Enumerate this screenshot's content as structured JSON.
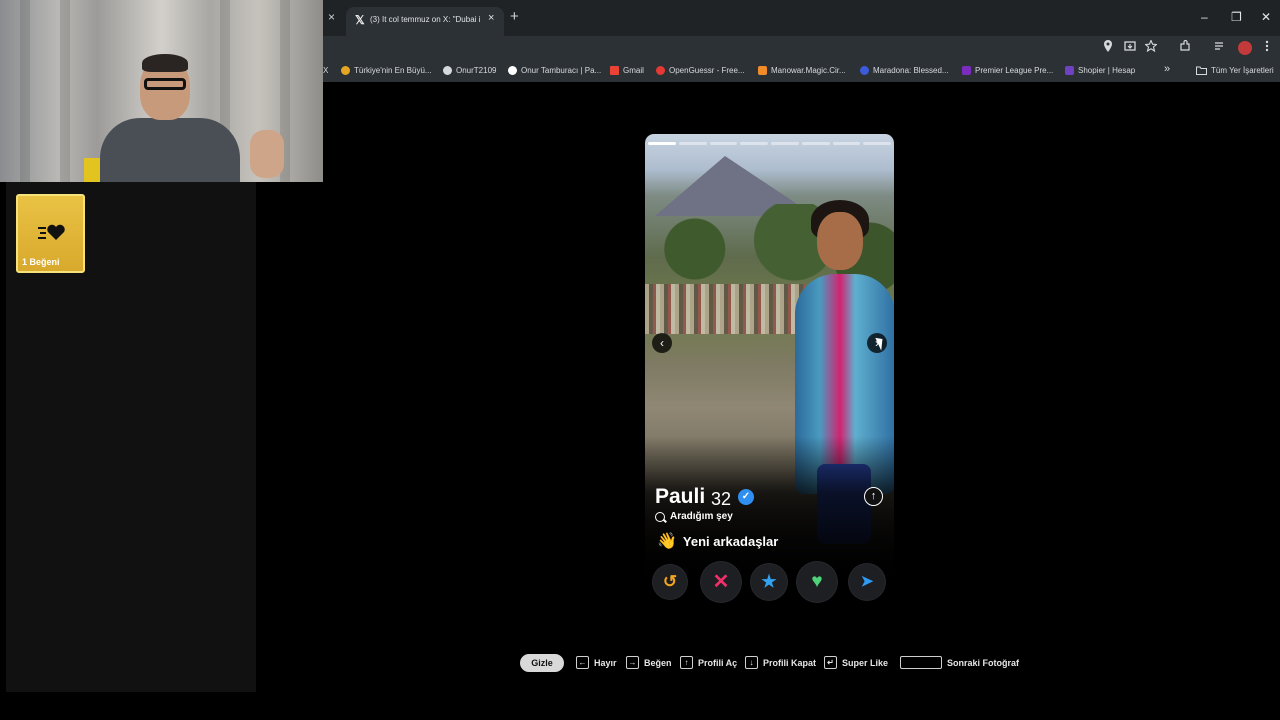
{
  "browser": {
    "tab": {
      "title": "(3) It col temmuz on X: \"Dubai i",
      "close": "×"
    },
    "other_tab_close": "×",
    "new_tab": "+",
    "window": {
      "minimize": "–",
      "restore": "❐",
      "close": "✕"
    },
    "toolbar_icons": [
      "location-icon",
      "install-icon",
      "star-icon",
      "extensions-icon",
      "media-icon",
      "profile-icon",
      "menu-icon"
    ],
    "bookmarks": [
      {
        "label": "X",
        "color": "#d7dadd"
      },
      {
        "label": "Türkiye'nin En Büyü...",
        "color": "#e5a523"
      },
      {
        "label": "OnurT2109",
        "color": "#d7dadd"
      },
      {
        "label": "Onur Tamburacı | Pa...",
        "color": "#ffffff"
      },
      {
        "label": "Gmail",
        "color": "#ea4335"
      },
      {
        "label": "OpenGuessr - Free...",
        "color": "#e53935"
      },
      {
        "label": "Manowar.Magic.Cir...",
        "color": "#f28c28"
      },
      {
        "label": "Maradona: Blessed...",
        "color": "#3b5bdb"
      },
      {
        "label": "Premier League Pre...",
        "color": "#7b2cbf"
      },
      {
        "label": "Shopier | Hesap",
        "color": "#6f42c1"
      }
    ],
    "bookmarks_overflow": "»",
    "all_bookmarks": "Tüm Yer İşaretleri"
  },
  "sidebar": {
    "likes_card": {
      "label": "1 Beğeni",
      "accent": "#e9c244"
    }
  },
  "profile": {
    "name": "Pauli",
    "age": "32",
    "verified": true,
    "looking_for_label": "Aradığım şey",
    "looking_for_value": "Yeni arkadaşlar",
    "looking_for_emoji": "👋",
    "photo_count": 8,
    "current_photo": 1,
    "nav_prev": "‹",
    "nav_next": "›",
    "info_icon": "↑"
  },
  "actions": {
    "rewind": "↺",
    "nope": "✕",
    "super_like": "★",
    "like": "♥",
    "boost": "➤"
  },
  "shortcuts": {
    "hide_label": "Gizle",
    "items": [
      {
        "key": "←",
        "label": "Hayır"
      },
      {
        "key": "→",
        "label": "Beğen"
      },
      {
        "key": "↑",
        "label": "Profili Aç"
      },
      {
        "key": "↓",
        "label": "Profili Kapat"
      },
      {
        "key": "↵",
        "label": "Super Like"
      },
      {
        "key": "",
        "label": "Sonraki Fotoğraf"
      }
    ]
  }
}
